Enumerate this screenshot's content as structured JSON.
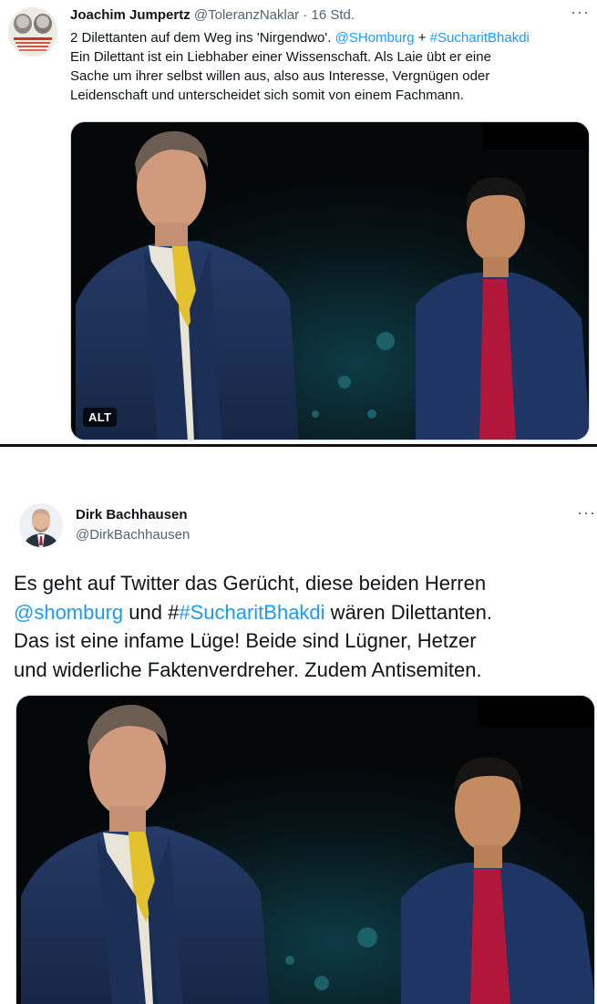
{
  "tweet1": {
    "author_name": "Joachim Jumpertz",
    "handle": "@ToleranzNaklar",
    "separator": "·",
    "time": "16 Std.",
    "more_icon": "more-dots-icon",
    "text_line1_prefix": "2 Dilettanten auf dem Weg ins 'Nirgendwo'. ",
    "mention": "@SHomburg",
    "plus": " + ",
    "hashtag": "#SucharitBhakdi",
    "text_line2": "Ein Dilettant ist ein Liebhaber einer Wissenschaft. Als Laie übt er eine",
    "text_line3": "Sache um ihrer selbst willen aus, also aus Interesse, Vergnügen oder",
    "text_line4": "Leidenschaft und unterscheidet sich somit von einem Fachmann.",
    "alt_badge": "ALT"
  },
  "tweet2": {
    "author_name": "Dirk Bachhausen",
    "handle": "@DirkBachhausen",
    "more_icon": "more-dots-icon",
    "line1": "Es geht auf Twitter das Gerücht, diese beiden Herren",
    "mention": "@shomburg",
    "line2_mid": " und #",
    "hashtag": "#SucharitBhakdi",
    "line2_end": " wären Dilettanten.",
    "line3": "Das ist eine infame Lüge! Beide sind Lügner, Hetzer",
    "line4": "und widerliche Faktenverdreher. Zudem Antisemiten."
  },
  "colors": {
    "link": "#1d9bf0",
    "text": "#0f1419",
    "secondary": "#536471"
  }
}
